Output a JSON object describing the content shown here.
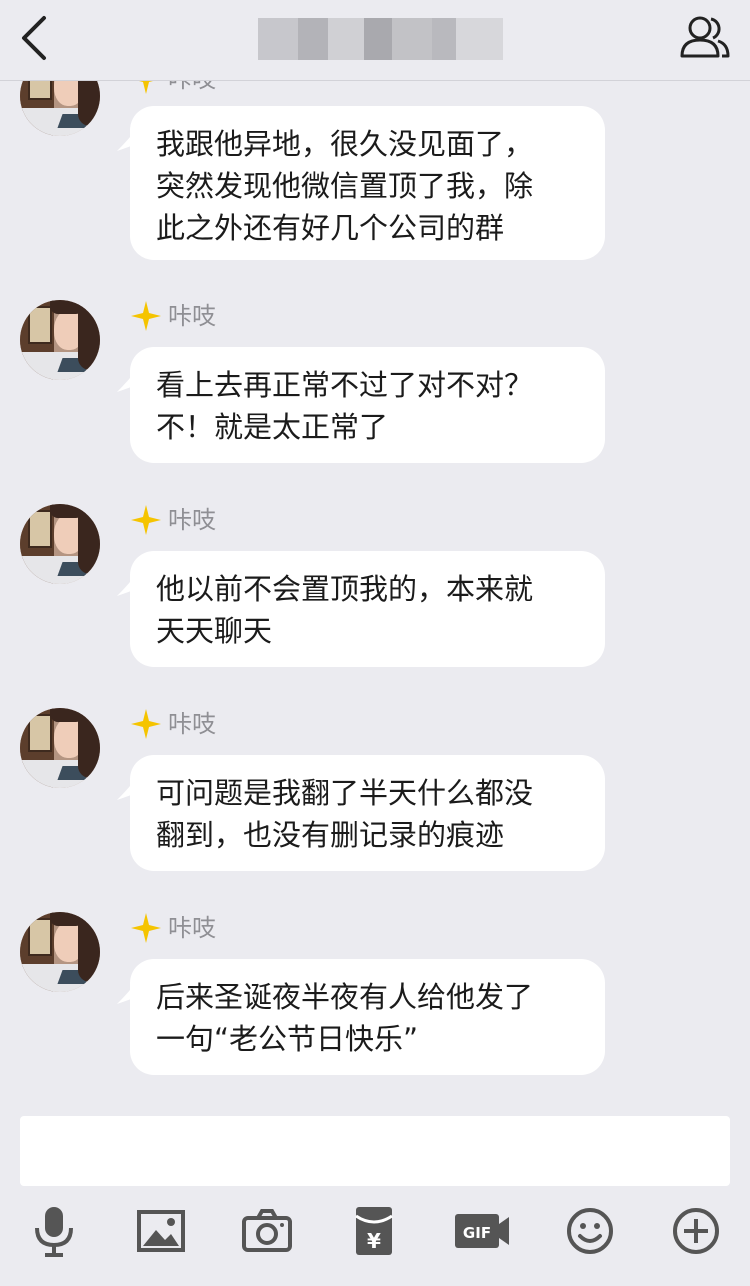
{
  "header": {
    "title_obscured": true,
    "back_icon": "chevron-left-icon",
    "contacts_icon": "group-members-icon"
  },
  "messages": [
    {
      "name": "咔吱",
      "text": "我跟他异地，很久没见面了，\n突然发现他微信置顶了我，除\n此之外还有好几个公司的群"
    },
    {
      "name": "咔吱",
      "text": "看上去再正常不过了对不对？\n不！就是太正常了"
    },
    {
      "name": "咔吱",
      "text": "他以前不会置顶我的，本来就\n天天聊天"
    },
    {
      "name": "咔吱",
      "text": "可问题是我翻了半天什么都没\n翻到，也没有删记录的痕迹"
    },
    {
      "name": "咔吱",
      "text": "后来圣诞夜半夜有人给他发了\n一句“老公节日快乐”"
    }
  ],
  "input": {
    "value": ""
  },
  "toolbar": {
    "items": [
      "mic-icon",
      "image-icon",
      "camera-icon",
      "red-packet-icon",
      "gif-icon",
      "emoji-icon",
      "plus-icon"
    ],
    "gif_label": "GIF",
    "yen_label": "¥"
  },
  "colors": {
    "background": "#ebebf0",
    "bubble": "#ffffff",
    "badge": "#f5c400",
    "icon": "#555555"
  }
}
